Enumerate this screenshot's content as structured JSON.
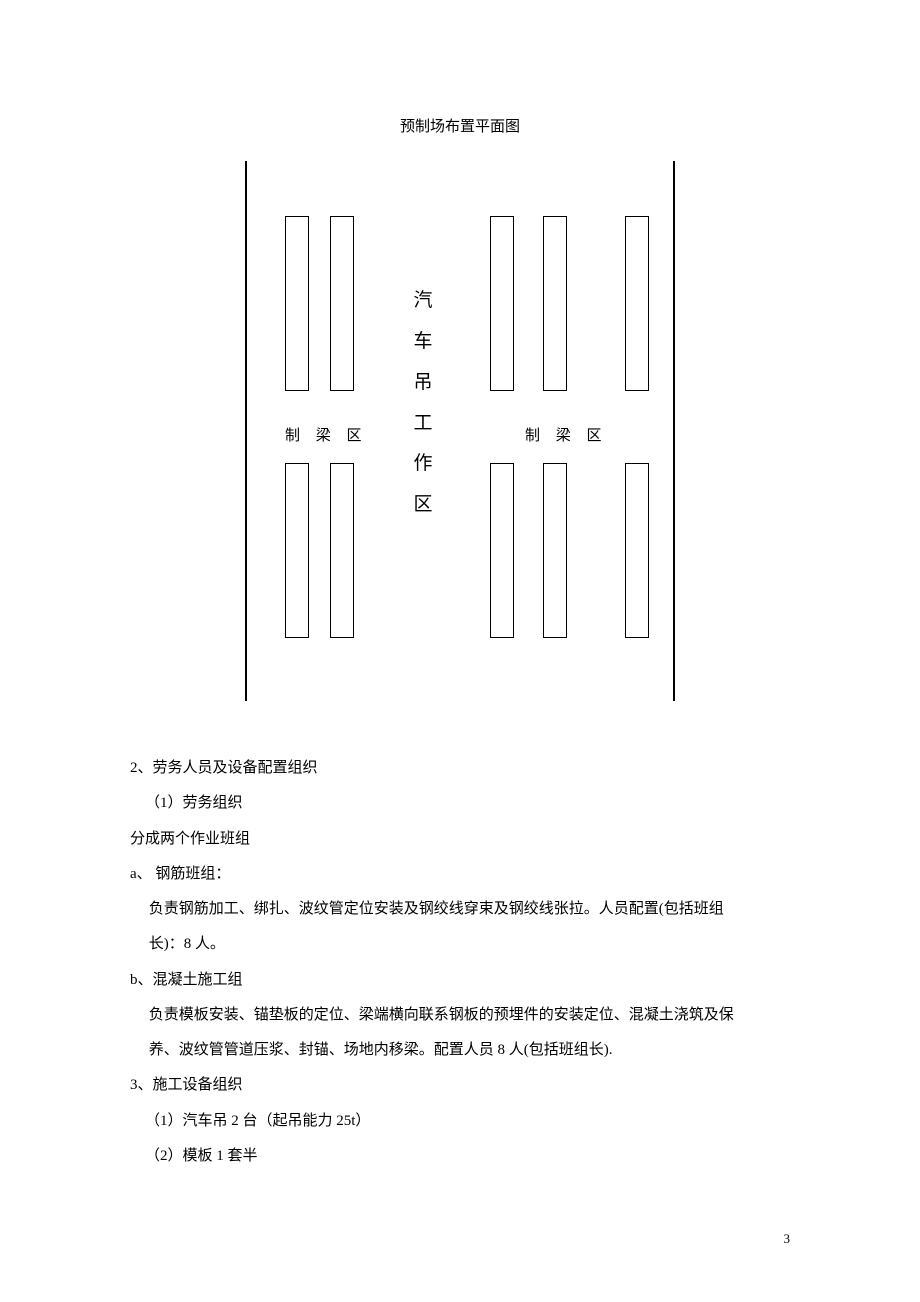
{
  "diagram": {
    "title": "预制场布置平面图",
    "center_label_chars": "汽车吊工作区",
    "zone_label_left": "制 梁 区",
    "zone_label_right": "制 梁 区"
  },
  "body": {
    "p1": "2、劳务人员及设备配置组织",
    "p2": "（1）劳务组织",
    "p3": "分成两个作业班组",
    "p4": "a、 钢筋班组：",
    "p5": "负责钢筋加工、绑扎、波纹管定位安装及钢绞线穿束及钢绞线张拉。人员配置(包括班组",
    "p6": "长)：8 人。",
    "p7": "b、混凝土施工组",
    "p8": "负责模板安装、锚垫板的定位、梁端横向联系钢板的预埋件的安装定位、混凝土浇筑及保",
    "p9": "养、波纹管管道压浆、封锚、场地内移梁。配置人员 8 人(包括班组长).",
    "p10": "3、施工设备组织",
    "p11": "（1）汽车吊 2 台（起吊能力 25t）",
    "p12": "（2）模板 1 套半"
  },
  "page_number": "3"
}
